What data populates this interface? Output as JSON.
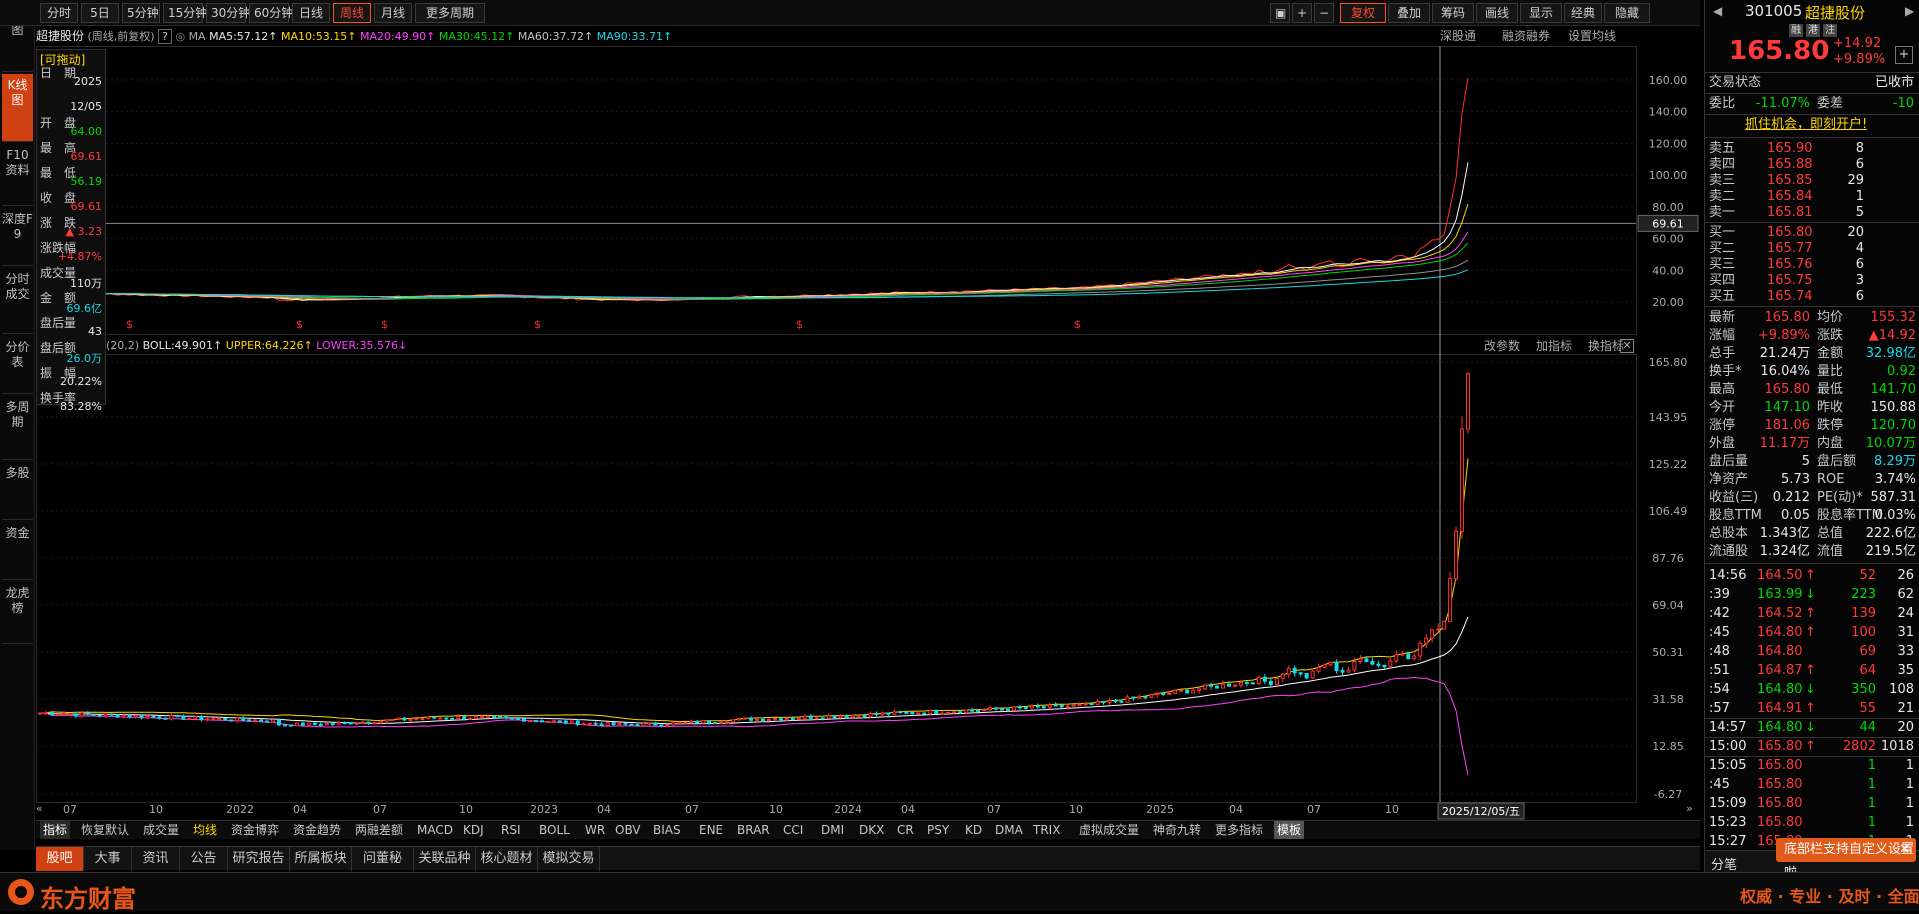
{
  "toolbar": {
    "periods": [
      "分时",
      "5日",
      "5分钟",
      "15分钟",
      "30分钟",
      "60分钟",
      "日线",
      "周线",
      "月线",
      "更多周期"
    ],
    "active_period": "周线",
    "right_buttons": [
      "复权",
      "叠加",
      "筹码",
      "画线",
      "显示",
      "经典",
      "隐藏"
    ]
  },
  "left_tabs": [
    "分时图",
    "K线图",
    "F10资料",
    "深度F9",
    "分时成交",
    "分价表",
    "多周期",
    "多股",
    "资金",
    "龙虎榜"
  ],
  "chart_header": {
    "stock_name": "超捷股份",
    "mode": "(周线,前复权)",
    "ma_label": "MA",
    "ma5": "MA5:57.12",
    "ma10": "MA10:53.15",
    "ma20": "MA20:49.90",
    "ma30": "MA30:45.12",
    "ma60": "MA60:37.72",
    "ma90": "MA90:33.71",
    "links": [
      "深股通",
      "融资融券",
      "设置均线"
    ]
  },
  "infobox": {
    "title": "[可拖动]",
    "rows": [
      {
        "label": "日　期",
        "value": "2025"
      },
      {
        "label": "",
        "value": "12/05"
      },
      {
        "label": "开　盘",
        "value": "64.00"
      },
      {
        "label": "最　高",
        "value": "69.61"
      },
      {
        "label": "最　低",
        "value": "56.19"
      },
      {
        "label": "收　盘",
        "value": "69.61"
      },
      {
        "label": "涨　跌",
        "value": "▲ 3.23"
      },
      {
        "label": "涨跌幅",
        "value": "+4.87%"
      },
      {
        "label": "成交量",
        "value": "110万"
      },
      {
        "label": "金　额",
        "value": "69.6亿"
      },
      {
        "label": "盘后量",
        "value": "43"
      },
      {
        "label": "盘后额",
        "value": "26.0万"
      },
      {
        "label": "振　幅",
        "value": "20.22%"
      },
      {
        "label": "换手率",
        "value": "83.28%"
      }
    ]
  },
  "lower_header": {
    "params": "(20,2)",
    "boll": "BOLL:49.901",
    "upper": "UPPER:64.226",
    "lower": "LOWER:35.576",
    "links": [
      "改参数",
      "加指标",
      "换指标"
    ]
  },
  "axis": {
    "upper_y": [
      "160.00",
      "140.00",
      "120.00",
      "100.00",
      "80.00",
      "60.00",
      "40.00",
      "20.00"
    ],
    "cursor_price": "69.61",
    "lower_y": [
      "165.80",
      "143.95",
      "125.22",
      "106.49",
      "87.76",
      "69.04",
      "50.31",
      "31.58",
      "12.85",
      "-6.27"
    ],
    "x_labels": [
      "07",
      "10",
      "2022",
      "04",
      "07",
      "10",
      "2023",
      "04",
      "07",
      "10",
      "2024",
      "04",
      "07",
      "10",
      "2025",
      "04",
      "07",
      "10"
    ],
    "cursor_date": "2025/12/05/五"
  },
  "indicator_bar": [
    "指标",
    "恢复默认",
    "成交量",
    "均线",
    "资金博弈",
    "资金趋势",
    "两融差额",
    "MACD",
    "KDJ",
    "RSI",
    "BOLL",
    "WR",
    "OBV",
    "BIAS",
    "ENE",
    "BRAR",
    "CCI",
    "DMI",
    "DKX",
    "CR",
    "PSY",
    "KD",
    "DMA",
    "TRIX",
    "虚拟成交量",
    "神奇九转",
    "更多指标",
    "模板"
  ],
  "bottom_tabs": [
    "股吧",
    "大事",
    "资讯",
    "公告",
    "研究报告",
    "所属板块",
    "问董秘",
    "关联品种",
    "核心题材",
    "模拟交易"
  ],
  "right_panel": {
    "code": "301005",
    "name": "超捷股份",
    "tags": [
      "融",
      "港",
      "注"
    ],
    "price": "165.80",
    "change": "+14.92",
    "pct": "+9.89%",
    "status_label": "交易状态",
    "status": "已收市",
    "weibi_label": "委比",
    "weibi": "-11.07%",
    "weicha_label": "委差",
    "weicha": "-10",
    "promo": "抓住机会，即刻开户!",
    "asks": [
      {
        "l": "卖五",
        "p": "165.90",
        "v": "8"
      },
      {
        "l": "卖四",
        "p": "165.88",
        "v": "6"
      },
      {
        "l": "卖三",
        "p": "165.85",
        "v": "29"
      },
      {
        "l": "卖二",
        "p": "165.84",
        "v": "1"
      },
      {
        "l": "卖一",
        "p": "165.81",
        "v": "5"
      }
    ],
    "bids": [
      {
        "l": "买一",
        "p": "165.80",
        "v": "20"
      },
      {
        "l": "买二",
        "p": "165.77",
        "v": "4"
      },
      {
        "l": "买三",
        "p": "165.76",
        "v": "6"
      },
      {
        "l": "买四",
        "p": "165.75",
        "v": "3"
      },
      {
        "l": "买五",
        "p": "165.74",
        "v": "6"
      }
    ],
    "stats": [
      {
        "a": "最新",
        "av": "165.80",
        "ac": "red",
        "b": "均价",
        "bv": "155.32",
        "bc": "red"
      },
      {
        "a": "涨幅",
        "av": "+9.89%",
        "ac": "red",
        "b": "涨跌",
        "bv": "▲14.92",
        "bc": "red"
      },
      {
        "a": "总手",
        "av": "21.24万",
        "ac": "wht",
        "b": "金额",
        "bv": "32.98亿",
        "bc": "cyan"
      },
      {
        "a": "换手*",
        "av": "16.04%",
        "ac": "wht",
        "b": "量比",
        "bv": "0.92",
        "bc": "grn"
      },
      {
        "a": "最高",
        "av": "165.80",
        "ac": "red",
        "b": "最低",
        "bv": "141.70",
        "bc": "grn"
      },
      {
        "a": "今开",
        "av": "147.10",
        "ac": "grn",
        "b": "昨收",
        "bv": "150.88",
        "bc": "wht"
      },
      {
        "a": "涨停",
        "av": "181.06",
        "ac": "red",
        "b": "跌停",
        "bv": "120.70",
        "bc": "grn"
      },
      {
        "a": "外盘",
        "av": "11.17万",
        "ac": "red",
        "b": "内盘",
        "bv": "10.07万",
        "bc": "grn"
      },
      {
        "a": "盘后量",
        "av": "5",
        "ac": "wht",
        "b": "盘后额",
        "bv": "8.29万",
        "bc": "cyan"
      },
      {
        "a": "净资产",
        "av": "5.73",
        "ac": "wht",
        "b": "ROE",
        "bv": "3.74%",
        "bc": "wht"
      },
      {
        "a": "收益(三)",
        "av": "0.212",
        "ac": "wht",
        "b": "PE(动)*",
        "bv": "587.31",
        "bc": "wht"
      },
      {
        "a": "股息TTM",
        "av": "0.05",
        "ac": "wht",
        "b": "股息率TTM",
        "bv": "0.03%",
        "bc": "wht"
      },
      {
        "a": "总股本",
        "av": "1.343亿",
        "ac": "wht",
        "b": "总值",
        "bv": "222.6亿",
        "bc": "wht"
      },
      {
        "a": "流通股",
        "av": "1.324亿",
        "ac": "wht",
        "b": "流值",
        "bv": "219.5亿",
        "bc": "wht"
      }
    ],
    "ticks": [
      {
        "t": "14:56",
        "p": "164.50",
        "a": "↑",
        "ac": "red",
        "v": "52",
        "vc": "red",
        "n": "26"
      },
      {
        "t": ":39",
        "p": "163.99",
        "a": "↓",
        "ac": "grn",
        "v": "223",
        "vc": "grn",
        "n": "62"
      },
      {
        "t": ":42",
        "p": "164.52",
        "a": "↑",
        "ac": "red",
        "v": "139",
        "vc": "red",
        "n": "24"
      },
      {
        "t": ":45",
        "p": "164.80",
        "a": "↑",
        "ac": "red",
        "v": "100",
        "vc": "red",
        "n": "31"
      },
      {
        "t": ":48",
        "p": "164.80",
        "a": "",
        "ac": "red",
        "v": "69",
        "vc": "red",
        "n": "33"
      },
      {
        "t": ":51",
        "p": "164.87",
        "a": "↑",
        "ac": "red",
        "v": "64",
        "vc": "red",
        "n": "35"
      },
      {
        "t": ":54",
        "p": "164.80",
        "a": "↓",
        "ac": "grn",
        "v": "350",
        "vc": "grn",
        "n": "108"
      },
      {
        "t": ":57",
        "p": "164.91",
        "a": "↑",
        "ac": "red",
        "v": "55",
        "vc": "red",
        "n": "21"
      },
      {
        "t": "14:57",
        "p": "164.80",
        "a": "↓",
        "ac": "grn",
        "v": "44",
        "vc": "grn",
        "n": "20"
      },
      {
        "t": "15:00",
        "p": "165.80",
        "a": "↑",
        "ac": "red",
        "v": "2802",
        "vc": "red",
        "n": "1018"
      },
      {
        "t": "15:05",
        "p": "165.80",
        "a": "",
        "ac": "red",
        "v": "1",
        "vc": "grn",
        "n": "1"
      },
      {
        "t": ":45",
        "p": "165.80",
        "a": "",
        "ac": "red",
        "v": "1",
        "vc": "grn",
        "n": "1"
      },
      {
        "t": "15:09",
        "p": "165.80",
        "a": "",
        "ac": "red",
        "v": "1",
        "vc": "grn",
        "n": "1"
      },
      {
        "t": "15:23",
        "p": "165.80",
        "a": "",
        "ac": "red",
        "v": "1",
        "vc": "grn",
        "n": "1"
      },
      {
        "t": "15:27",
        "p": "165.80",
        "a": "",
        "ac": "red",
        "v": "1",
        "vc": "grn",
        "n": "1"
      }
    ],
    "bottom_tab": "分笔",
    "toast": "底部栏支持自定义设置啦"
  },
  "footer": {
    "brand": "东方财富",
    "slogan": "权威 · 专业 · 及时 · 全面"
  }
}
